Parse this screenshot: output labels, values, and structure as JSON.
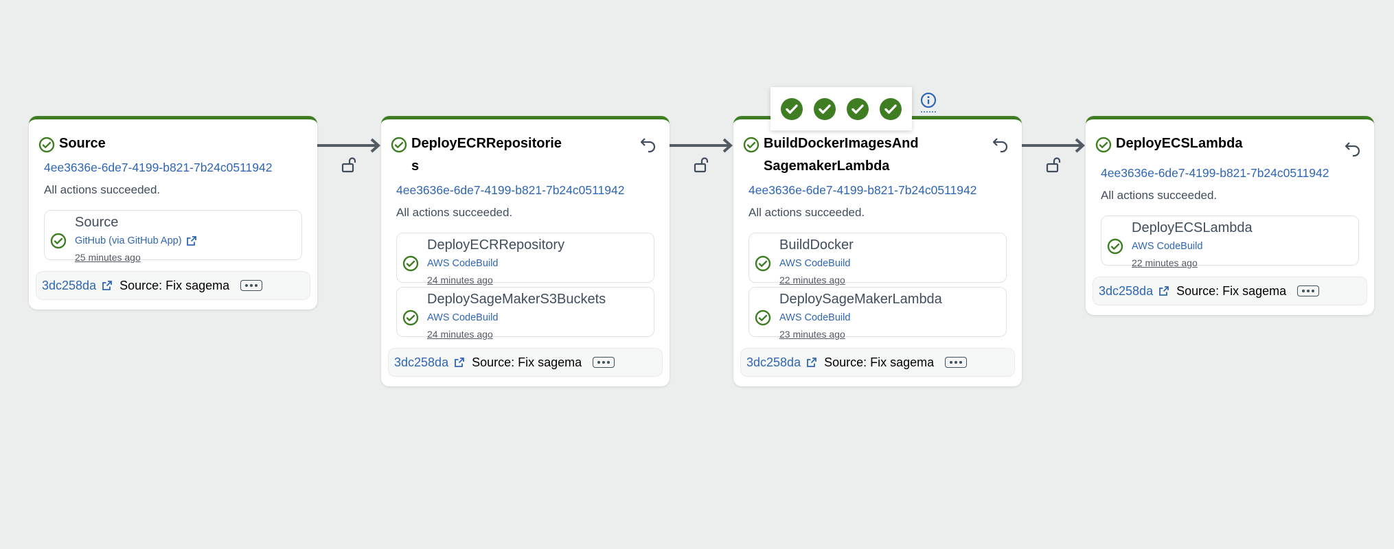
{
  "colors": {
    "success": "#3f7d23",
    "link": "#2f66b3",
    "stage_bar": "#3f7d23"
  },
  "transition_popover": {
    "icons": [
      "check-circle-filled-icon",
      "check-circle-filled-icon",
      "check-circle-filled-icon",
      "check-circle-filled-icon"
    ]
  },
  "stages": [
    {
      "title": "Source",
      "execution_id": "4ee3636e-6de7-4199-b821-7b24c0511942",
      "status": "All actions succeeded.",
      "actions": [
        {
          "name": "Source",
          "provider": "GitHub (via GitHub App)",
          "time": "25 minutes ago"
        }
      ],
      "commit": {
        "id": "3dc258da",
        "message": "Source: Fix sagema"
      }
    },
    {
      "title": "DeployECRRepositories",
      "execution_id": "4ee3636e-6de7-4199-b821-7b24c0511942",
      "status": "All actions succeeded.",
      "actions": [
        {
          "name": "DeployECRRepository",
          "provider": "AWS CodeBuild",
          "time": "24 minutes ago"
        },
        {
          "name": "DeploySageMakerS3Buckets",
          "provider": "AWS CodeBuild",
          "time": "24 minutes ago"
        }
      ],
      "commit": {
        "id": "3dc258da",
        "message": "Source: Fix sagema"
      }
    },
    {
      "title": "BuildDockerImagesAndSagemakerLambda",
      "execution_id": "4ee3636e-6de7-4199-b821-7b24c0511942",
      "status": "All actions succeeded.",
      "actions": [
        {
          "name": "BuildDocker",
          "provider": "AWS CodeBuild",
          "time": "22 minutes ago"
        },
        {
          "name": "DeploySageMakerLambda",
          "provider": "AWS CodeBuild",
          "time": "23 minutes ago"
        }
      ],
      "commit": {
        "id": "3dc258da",
        "message": "Source: Fix sagema"
      }
    },
    {
      "title": "DeployECSLambda",
      "execution_id": "4ee3636e-6de7-4199-b821-7b24c0511942",
      "status": "All actions succeeded.",
      "actions": [
        {
          "name": "DeployECSLambda",
          "provider": "AWS CodeBuild",
          "time": "22 minutes ago"
        }
      ],
      "commit": {
        "id": "3dc258da",
        "message": "Source: Fix sagema"
      }
    }
  ]
}
